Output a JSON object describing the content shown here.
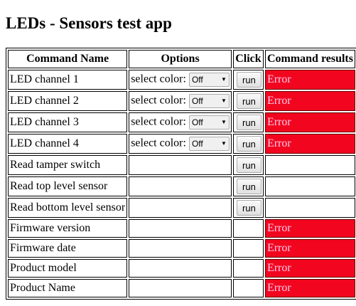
{
  "title": "LEDs - Sensors test app",
  "headers": [
    "Command Name",
    "Options",
    "Click",
    "Command results"
  ],
  "rows": [
    {
      "name": "LED channel 1",
      "label": "select color:",
      "select": "Off",
      "button": "run",
      "result": "Error"
    },
    {
      "name": "LED channel 2",
      "label": "select color:",
      "select": "Off",
      "button": "run",
      "result": "Error"
    },
    {
      "name": "LED channel 3",
      "label": "select color:",
      "select": "Off",
      "button": "run",
      "result": "Error"
    },
    {
      "name": "LED channel 4",
      "label": "select color:",
      "select": "Off",
      "button": "run",
      "result": "Error"
    },
    {
      "name": "Read tamper switch",
      "button": "run",
      "result": ""
    },
    {
      "name": "Read top level sensor",
      "button": "run",
      "result": ""
    },
    {
      "name": "Read bottom level sensor",
      "button": "run",
      "result": ""
    },
    {
      "name": "Firmware version",
      "result": "Error"
    },
    {
      "name": "Firmware date",
      "result": "Error"
    },
    {
      "name": "Product model",
      "result": "Error"
    },
    {
      "name": "Product Name",
      "result": "Error"
    }
  ],
  "colors": {
    "error": "#f2061f"
  }
}
